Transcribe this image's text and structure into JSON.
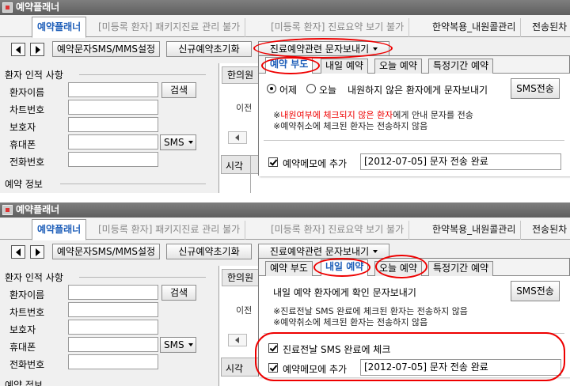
{
  "panels": [
    {
      "window_title": "예약플래너",
      "main_tabs": [
        "예약플래너",
        "[미등록 환자] 패키지진료 관리 불가",
        "[미등록 환자] 진료요약 보기 불가",
        "한약복용_내원콜관리",
        "전송된차"
      ],
      "toolbar": {
        "sms_settings_button": "예약문자SMS/MMS설정",
        "new_reservation_reset_button": "신규예약초기화",
        "treatment_sms_dropdown": "진료예약관련 문자보내기"
      },
      "patient_group": {
        "title": "환자 인적 사항",
        "fields": [
          "환자이름",
          "차트번호",
          "보호자",
          "휴대폰",
          "전화번호"
        ],
        "search_button": "검색",
        "sms_dropdown": "SMS",
        "reservation_group_title": "예약 정보"
      },
      "background": {
        "clinic_tab": "한의원",
        "prev_label": "이전",
        "grid_time_header": "시각"
      },
      "popup": {
        "tabs": [
          "예약 부도",
          "내일 예약",
          "오늘 예약",
          "특정기간 예약"
        ],
        "active_tab": 0,
        "radio_yesterday": "어제",
        "radio_today": "오늘",
        "send_desc": "내원하지 않은 환자에게 문자보내기",
        "send_button": "SMS전송",
        "note1_pre": "※",
        "note1_red": "내원여부에 체크되지 않은 환자",
        "note1_post": "에게 안내 문자를 전송",
        "note2": "※예약취소에 체크된 환자는 전송하지 않음",
        "memo_check_label": "예약메모에 추가",
        "memo_value": "[2012-07-05] 문자 전송 완료"
      }
    },
    {
      "window_title": "예약플래너",
      "main_tabs": [
        "예약플래너",
        "[미등록 환자] 패키지진료 관리 불가",
        "[미등록 환자] 진료요약 보기 불가",
        "한약복용_내원콜관리",
        "전송된차"
      ],
      "toolbar": {
        "sms_settings_button": "예약문자SMS/MMS설정",
        "new_reservation_reset_button": "신규예약초기화",
        "treatment_sms_dropdown": "진료예약관련 문자보내기"
      },
      "patient_group": {
        "title": "환자 인적 사항",
        "fields": [
          "환자이름",
          "차트번호",
          "보호자",
          "휴대폰",
          "전화번호"
        ],
        "search_button": "검색",
        "sms_dropdown": "SMS",
        "reservation_group_title": "예약 정보"
      },
      "background": {
        "clinic_tab": "한의원",
        "prev_label": "이전",
        "grid_time_header": "시각"
      },
      "popup": {
        "tabs": [
          "예약 부도",
          "내일 예약",
          "오늘 예약",
          "특정기간 예약"
        ],
        "active_tab": 1,
        "send_desc": "내일 예약 환자에게 확인 문자보내기",
        "send_button": "SMS전송",
        "note1": "※진료전날 SMS 완료에 체크된 환자는 전송하지 않음",
        "note2": "※예약취소에 체크된 환자는 전송하지 않음",
        "sms_done_check_label": "진료전날 SMS 완료에 체크",
        "memo_check_label": "예약메모에 추가",
        "memo_value": "[2012-07-05] 문자 전송 완료"
      }
    }
  ],
  "colors": {
    "accent_blue": "#1f5fb9",
    "highlight_red": "#e00000",
    "titlebar_gray": "#6e6e6e"
  }
}
